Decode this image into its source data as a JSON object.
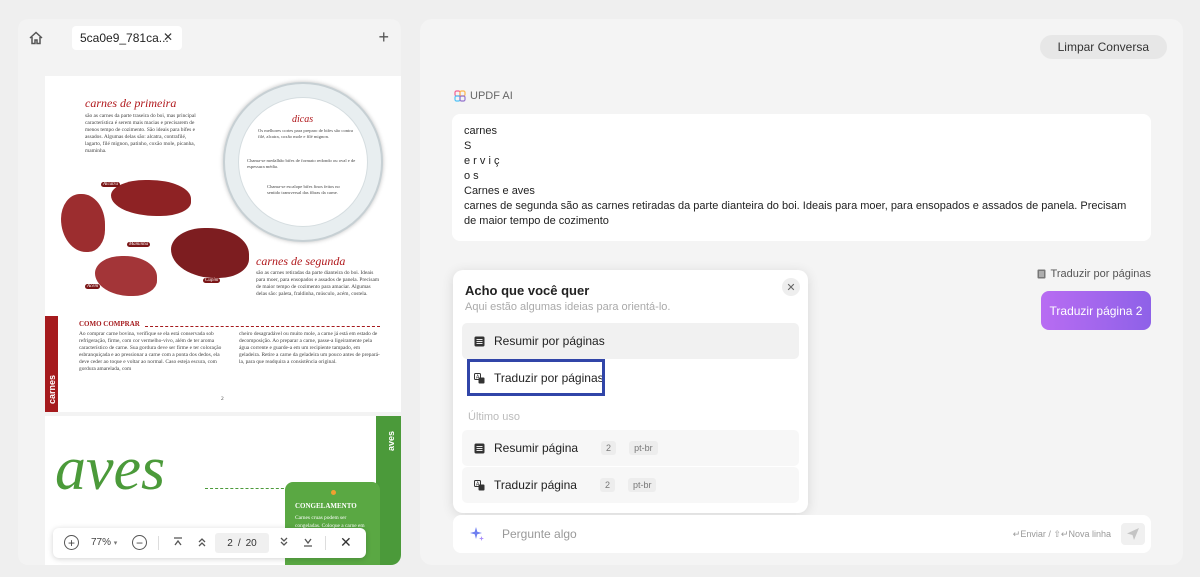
{
  "tabs": {
    "file_name": "5ca0e9_781ca..."
  },
  "pdf": {
    "page1": {
      "title_primeira": "carnes de primeira",
      "text_primeira": "são as carnes da parte traseira do boi, mas principal característica é serem mais macias e precisarem de menos tempo de cozimento. São ideais para bifes e assados. Algumas delas são: alcatra, contrafilé, lagarto, filé mignon, patinho, coxão mole, picanha, maminha.",
      "dicas_title": "dicas",
      "dicas_1": "Os melhores cortes para preparo de bifes são contra filé, alcatra, coxão mole e filé mignon.",
      "dicas_2": "Chama-se medalhão bifes de formato redondo ou oval e de espessura média.",
      "dicas_3": "Chama-se escalope bifes finos feitos no sentido transversal das fibras da carne.",
      "label_alcatra": "Alcatra",
      "label_maminha": "Maminha",
      "label_cupim": "Cupim",
      "label_acem": "Acém",
      "title_segunda": "carnes de segunda",
      "text_segunda": "são as carnes retiradas da parte dianteira do boi. Ideais para moer, para ensopados e assados de panela. Precisam de maior tempo de cozimento para amaciar. Algumas delas são: paleta, fraldinha, músculo, acém, costela.",
      "como_title": "COMO COMPRAR",
      "como_left": "Ao comprar carne bovina, verifique se ela está conservada sob refrigeração, firme, com cor vermelho-vivo, além de ter aroma característico de carne. Sua gordura deve ser firme e ter coloração esbranquiçada e ao pressionar a carne com a ponta dos dedos, ela deve ceder ao toque e voltar ao normal. Caso esteja escura, com gordura amarelada, com",
      "como_right": "cheiro desagradável ou muito mole, a carne já está em estado de decomposição. Ao preparar a carne, passe-a ligeiramente pela água corrente e guarde-a em um recipiente tampado, em geladeira. Retire a carne da geladeira um pouco antes de prepará-la, para que readquira a consistência original.",
      "page_number": "2",
      "band_label": "carnes"
    },
    "page2": {
      "title": "aves",
      "band_label": "aves",
      "box_title": "CONGELAMENTO",
      "box_text": "Carnes cruas podem ser congeladas. Coloque a carne em saco plástico para uso"
    },
    "toolbar": {
      "zoom": "77%",
      "current_page": "2",
      "page_sep": "/",
      "total_pages": "20"
    }
  },
  "chat": {
    "clear_label": "Limpar Conversa",
    "ai_name": "UPDF AI",
    "answer_lines": [
      "carnes",
      "S",
      "e r v i ç",
      "o s",
      "Carnes e aves",
      "carnes de segunda são as carnes retiradas da parte dianteira do boi. Ideais para moer, para ensopados e assados de panela. Precisam",
      "de maior tempo de cozimento"
    ],
    "translate_pages_label": "Traduzir por páginas",
    "translate_page_button": "Traduzir página 2"
  },
  "popup": {
    "title": "Acho que você quer",
    "subtitle": "Aqui estão algumas ideias para orientá-lo.",
    "items": [
      {
        "label": "Resumir por páginas",
        "icon": "list-icon"
      },
      {
        "label": "Traduzir por páginas",
        "icon": "translate-icon"
      }
    ],
    "last_use_label": "Último uso",
    "recent": [
      {
        "label": "Resumir página",
        "page": "2",
        "lang": "pt-br",
        "icon": "list-icon"
      },
      {
        "label": "Traduzir página",
        "page": "2",
        "lang": "pt-br",
        "icon": "translate-icon"
      }
    ]
  },
  "input": {
    "placeholder": "Pergunte algo",
    "hint_send": "Enviar",
    "hint_separator": "/",
    "hint_newline": "Nova linha"
  },
  "colors": {
    "accent_gradient_start": "#b86cf2",
    "accent_gradient_end": "#8e61e8",
    "focus_border": "#3145a8",
    "meat_red": "#a51a1d",
    "aves_green": "#4b9a3a"
  }
}
